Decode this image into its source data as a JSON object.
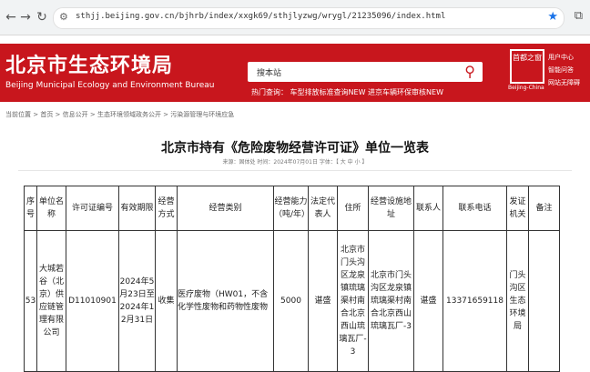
{
  "browser": {
    "url": "sthjj.beijing.gov.cn/bjhrb/index/xxgk69/sthjlyzwg/wrygl/21235096/index.html"
  },
  "header": {
    "title_cn": "北京市生态环境局",
    "title_en": "Beijing Municipal Ecology and Environment Bureau",
    "search_placeholder": "搜本站",
    "hot_query": "热门查询：  车型排放标准查询NEW  进京车辆环保审核NEW",
    "seal_text": "首都之窗",
    "seal_caption": "Beijing-China",
    "links": [
      "用户中心",
      "智能问答",
      "网站无障碍"
    ]
  },
  "breadcrumb": "当前位置 > 首页 > 信息公开 > 生态环境领域政务公开 > 污染源管理与环境应急",
  "page": {
    "title": "北京市持有《危险废物经营许可证》单位一览表",
    "meta": "来源：固体处    时间：2024年07月01日    字体：【 大  中  小 】"
  },
  "table": {
    "headers": [
      "序号",
      "单位名称",
      "许可证编号",
      "有效期限",
      "经营方式",
      "经营类别",
      "经营能力（吨/年）",
      "法定代表人",
      "住所",
      "经营设施地址",
      "联系人",
      "联系电话",
      "发证机关",
      "备注"
    ],
    "row": [
      "53",
      "大城若谷（北京）供应链管理有限公司",
      "D11010901",
      "2024年5月23日至2024年12月31日",
      "收集",
      "医疗废物（HW01，不含化学性废物和药物性废物",
      "5000",
      "谌盛",
      "北京市门头沟区龙泉镇琉璃渠村南合北京西山琉璃瓦厂-3",
      "北京市门头沟区龙泉镇琉璃渠村南合北京西山琉璃瓦厂-3",
      "谌盛",
      "13371659118",
      "门头沟区生态环境局",
      ""
    ]
  },
  "colors": {
    "brand_red": "#c8161d"
  }
}
